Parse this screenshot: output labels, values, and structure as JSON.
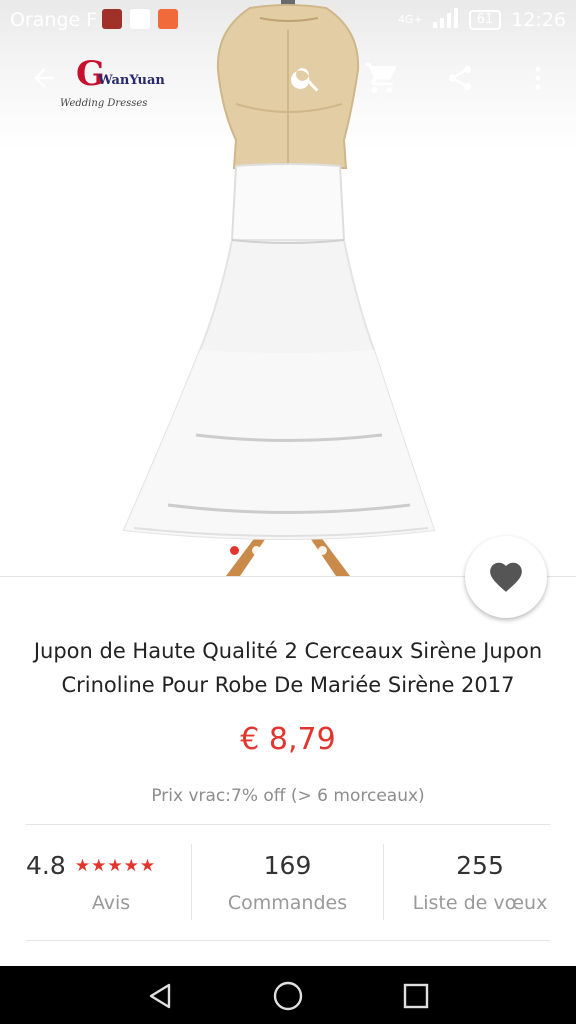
{
  "status_bar": {
    "carrier": "Orange F",
    "network": "4G+",
    "battery": "61",
    "time": "12:26"
  },
  "toolbar": {
    "logo_mark": "G",
    "logo_name": "WanYuan",
    "logo_tagline": "Wedding Dresses",
    "icons": [
      "back-arrow-icon",
      "search-icon",
      "cart-icon",
      "share-icon",
      "more-vert-icon"
    ]
  },
  "gallery": {
    "image_count": 5,
    "active_index": 0
  },
  "product": {
    "title": "Jupon de Haute Qualité 2 Cerceaux Sirène Jupon Crinoline Pour Robe De Mariée Sirène 2017",
    "price": "€ 8,79",
    "bulk_price": "Prix vrac:7% off (> 6 morceaux)"
  },
  "stats": {
    "rating": "4.8",
    "rating_stars": "★★★★★",
    "rating_label": "Avis",
    "orders": "169",
    "orders_label": "Commandes",
    "wishlist": "255",
    "wishlist_label": "Liste de vœux"
  },
  "colors": {
    "accent": "#e3352e",
    "text": "#222222",
    "muted": "#999999"
  }
}
